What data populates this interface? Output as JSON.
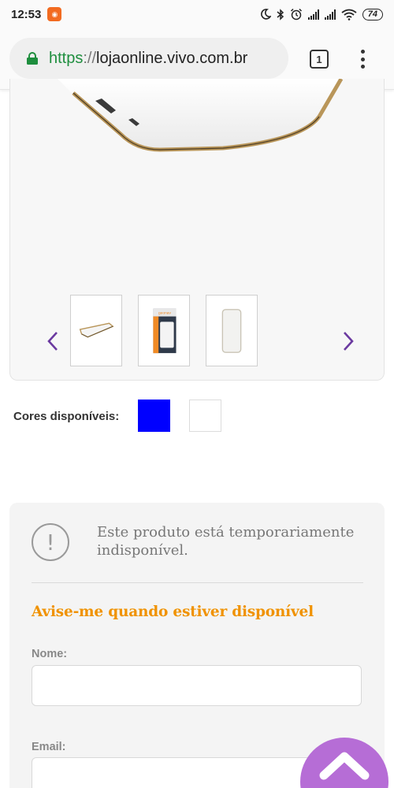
{
  "status_bar": {
    "time": "12:53",
    "battery": "74",
    "icons": [
      "app-notification-icon",
      "moon-icon",
      "bluetooth-icon",
      "alarm-icon",
      "signal-icon",
      "signal-icon",
      "wifi-icon",
      "battery-icon"
    ]
  },
  "browser": {
    "url_scheme": "https",
    "url_separator": "://",
    "url_host": "lojaonline.vivo.com.br",
    "tab_count": "1"
  },
  "gallery": {
    "thumbnails": [
      "thumbnail-powerbank-flat",
      "thumbnail-powerbank-package",
      "thumbnail-powerbank-front"
    ],
    "prev_icon": "chevron-left-icon",
    "next_icon": "chevron-right-icon",
    "package_brand": "geonav",
    "accent_color": "#6b3aa0"
  },
  "colors": {
    "label": "Cores disponíveis:",
    "options": [
      "#0000ff",
      "#ffffff"
    ]
  },
  "unavailable": {
    "message": "Este produto está temporariamente indisponível.",
    "notify_title": "Avise-me quando estiver disponível",
    "name_label": "Nome:",
    "email_label": "Email:",
    "title_color": "#f09200"
  },
  "scroll_top": {
    "icon": "chevron-up-icon",
    "color": "#b66dd6"
  }
}
